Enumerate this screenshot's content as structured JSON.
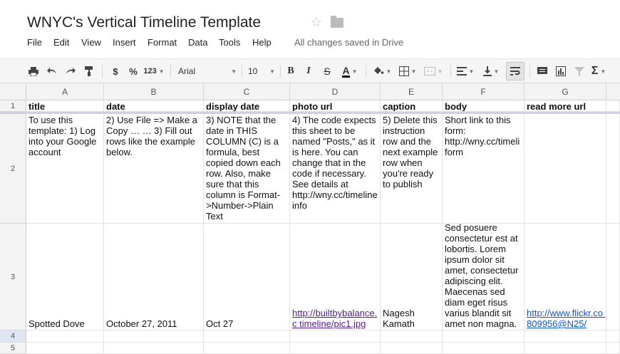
{
  "document": {
    "title": "WNYC's Vertical Timeline Template"
  },
  "menu": {
    "items": [
      "File",
      "Edit",
      "View",
      "Insert",
      "Format",
      "Data",
      "Tools",
      "Help"
    ],
    "save_status": "All changes saved in Drive"
  },
  "toolbar": {
    "currency": "$",
    "percent": "%",
    "number_format": "123",
    "font_family": "Arial",
    "font_size": "10",
    "bold": "B",
    "italic": "I",
    "strikethrough": "S",
    "text_color_glyph": "A",
    "sum_glyph": "Σ"
  },
  "columns": [
    "A",
    "B",
    "C",
    "D",
    "E",
    "F",
    "G"
  ],
  "rows": [
    "1",
    "2",
    "3",
    "4",
    "5"
  ],
  "sheet": {
    "row1": [
      "title",
      "date",
      "display date",
      "photo url",
      "caption",
      "body",
      "read more url"
    ],
    "row2": [
      "To use this template: 1) Log into your Google account",
      "2) Use File => Make a Copy … … 3) Fill out rows like the example below.",
      "3) NOTE that the date in THIS COLUMN (C) is a formula, best copied down each row. Also, make sure that this column is Format->Number->Plain Text",
      "4) The code expects this sheet to be named \"Posts,\" as it is here. You can change that in the code if necessary. See details at http://wny.cc/timeline info",
      "5) Delete this instruction row and the next example row when you're ready to publish",
      "Short link to this form: http://wny.cc/timeli form",
      ""
    ],
    "row3": [
      "Spotted Dove",
      "October 27, 2011",
      "Oct 27",
      "http://builtbybalance.c timeline/pic1.jpg",
      "Nagesh Kamath",
      "Sed posuere consectetur est at lobortis. Lorem ipsum dolor sit amet, consectetur adipiscing elit. Maecenas sed diam eget risus varius blandit sit amet non magna.",
      "http://www.flickr.co 809956@N25/"
    ]
  }
}
